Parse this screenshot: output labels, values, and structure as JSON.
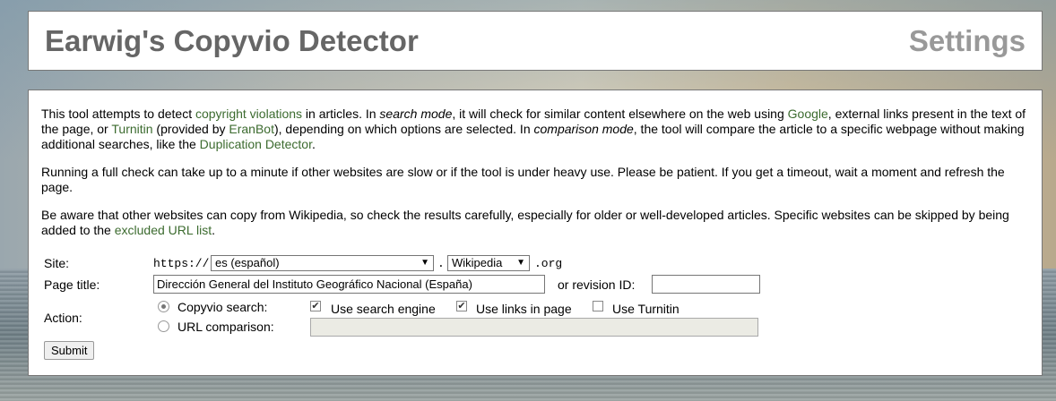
{
  "header": {
    "title": "Earwig's Copyvio Detector",
    "settings_link": "Settings"
  },
  "intro": {
    "p1": [
      {
        "text": "This tool attempts to detect ",
        "type": "text"
      },
      {
        "text": "copyright violations",
        "type": "link"
      },
      {
        "text": " in articles. In ",
        "type": "text"
      },
      {
        "text": "search mode",
        "type": "em"
      },
      {
        "text": ", it will check for similar content elsewhere on the web using ",
        "type": "text"
      },
      {
        "text": "Google",
        "type": "link"
      },
      {
        "text": ", external links present in the text of the page, or ",
        "type": "text"
      },
      {
        "text": "Turnitin",
        "type": "link"
      },
      {
        "text": " (provided by ",
        "type": "text"
      },
      {
        "text": "EranBot",
        "type": "link"
      },
      {
        "text": "), depending on which options are selected. In ",
        "type": "text"
      },
      {
        "text": "comparison mode",
        "type": "em"
      },
      {
        "text": ", the tool will compare the article to a specific webpage without making additional searches, like the ",
        "type": "text"
      },
      {
        "text": "Duplication Detector",
        "type": "link"
      },
      {
        "text": ".",
        "type": "text"
      }
    ],
    "p2": "Running a full check can take up to a minute if other websites are slow or if the tool is under heavy use. Please be patient. If you get a timeout, wait a moment and refresh the page.",
    "p3": [
      {
        "text": "Be aware that other websites can copy from Wikipedia, so check the results carefully, especially for older or well-developed articles. Specific websites can be skipped by being added to the ",
        "type": "text"
      },
      {
        "text": "excluded URL list",
        "type": "link"
      },
      {
        "text": ".",
        "type": "text"
      }
    ]
  },
  "form": {
    "site_label": "Site:",
    "protocol": "https://",
    "language_selected": "es (español)",
    "dot": ".",
    "project_selected": "Wikipedia",
    "tld": ".org",
    "page_title_label": "Page title:",
    "page_title_value": "Dirección General del Instituto Geográfico Nacional (España)",
    "revision_label": "or revision ID:",
    "revision_value": "",
    "action_label": "Action:",
    "copyvio_search_label": "Copyvio search:",
    "copyvio_search_checked": true,
    "use_search_engine_label": "Use search engine",
    "use_search_engine_checked": true,
    "use_links_label": "Use links in page",
    "use_links_checked": true,
    "use_turnitin_label": "Use Turnitin",
    "use_turnitin_checked": false,
    "url_comparison_label": "URL comparison:",
    "url_comparison_checked": false,
    "url_value": "",
    "submit_label": "Submit"
  }
}
